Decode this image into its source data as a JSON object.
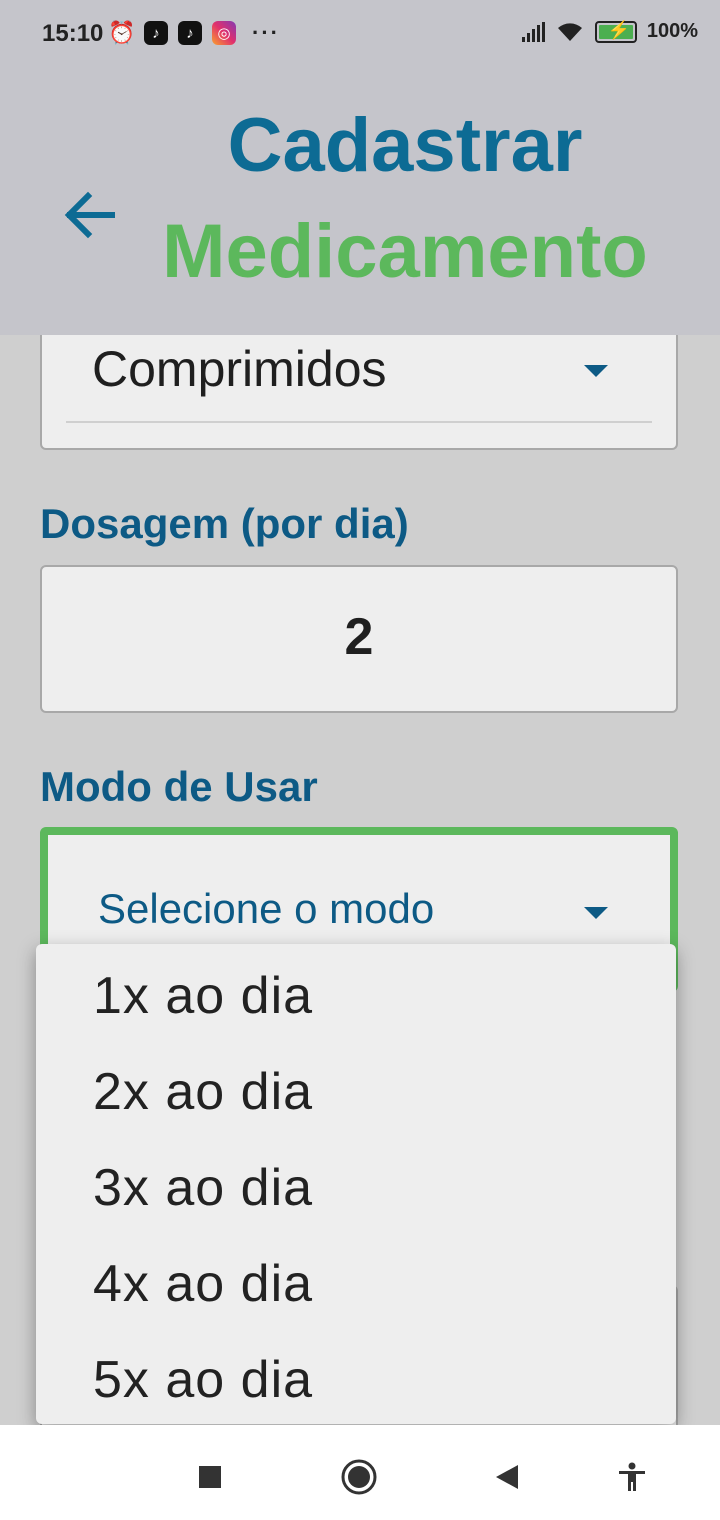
{
  "status_bar": {
    "time": "15:10",
    "icons_left": [
      "alarm-icon",
      "tiktok-icon",
      "tiktok-icon",
      "instagram-icon"
    ],
    "more": "···",
    "battery": "100%"
  },
  "header": {
    "title_line1": "Cadastrar",
    "title_line2": "Medicamento",
    "title_color1": "#0d6b94",
    "title_color2": "#5cb85c"
  },
  "form": {
    "tipo_value": "Comprimidos",
    "dosagem_label": "Dosagem (por dia)",
    "dosagem_value": "2",
    "modo_label": "Modo de Usar",
    "modo_placeholder": "Selecione o modo"
  },
  "dropdown": {
    "options": [
      "1x ao dia",
      "2x ao dia",
      "3x ao dia",
      "4x ao dia",
      "5x ao dia"
    ]
  },
  "nav_bar": {
    "buttons": [
      "recents-icon",
      "home-icon",
      "back-icon",
      "accessibility-icon"
    ]
  },
  "colors": {
    "accent_green": "#5cb85c",
    "label_blue": "#0d5a85",
    "header_bg": "#c5c5cb"
  }
}
